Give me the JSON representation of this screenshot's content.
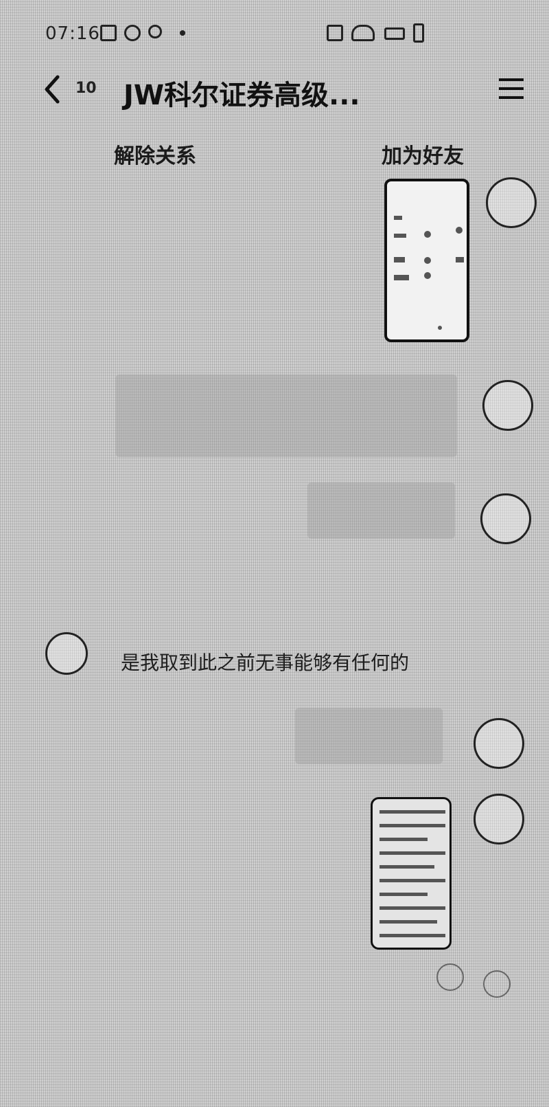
{
  "status_bar": {
    "time": "07:16",
    "icons": [
      "image-icon",
      "circle-icon",
      "notification-icon",
      "chat-icon",
      "signal-icon",
      "battery-icon"
    ]
  },
  "header": {
    "back_icon": "chevron-left-icon",
    "unread_count": "10",
    "title": "JW科尔证券高级...",
    "menu_icon": "menu-icon"
  },
  "relation_bar": {
    "unlink_label": "解除关系",
    "add_friend_label": "加为好友"
  },
  "messages": [
    {
      "from": "self",
      "type": "image"
    },
    {
      "from": "self",
      "type": "bubble"
    },
    {
      "from": "self",
      "type": "bubble"
    },
    {
      "from": "other",
      "type": "system",
      "text": "是我取到此之前无事能够有任何的"
    },
    {
      "from": "self",
      "type": "bubble"
    },
    {
      "from": "self",
      "type": "image"
    }
  ],
  "colors": {
    "background": "#c9c9c9",
    "text": "#1b1b1b",
    "bubble": "#969696"
  }
}
